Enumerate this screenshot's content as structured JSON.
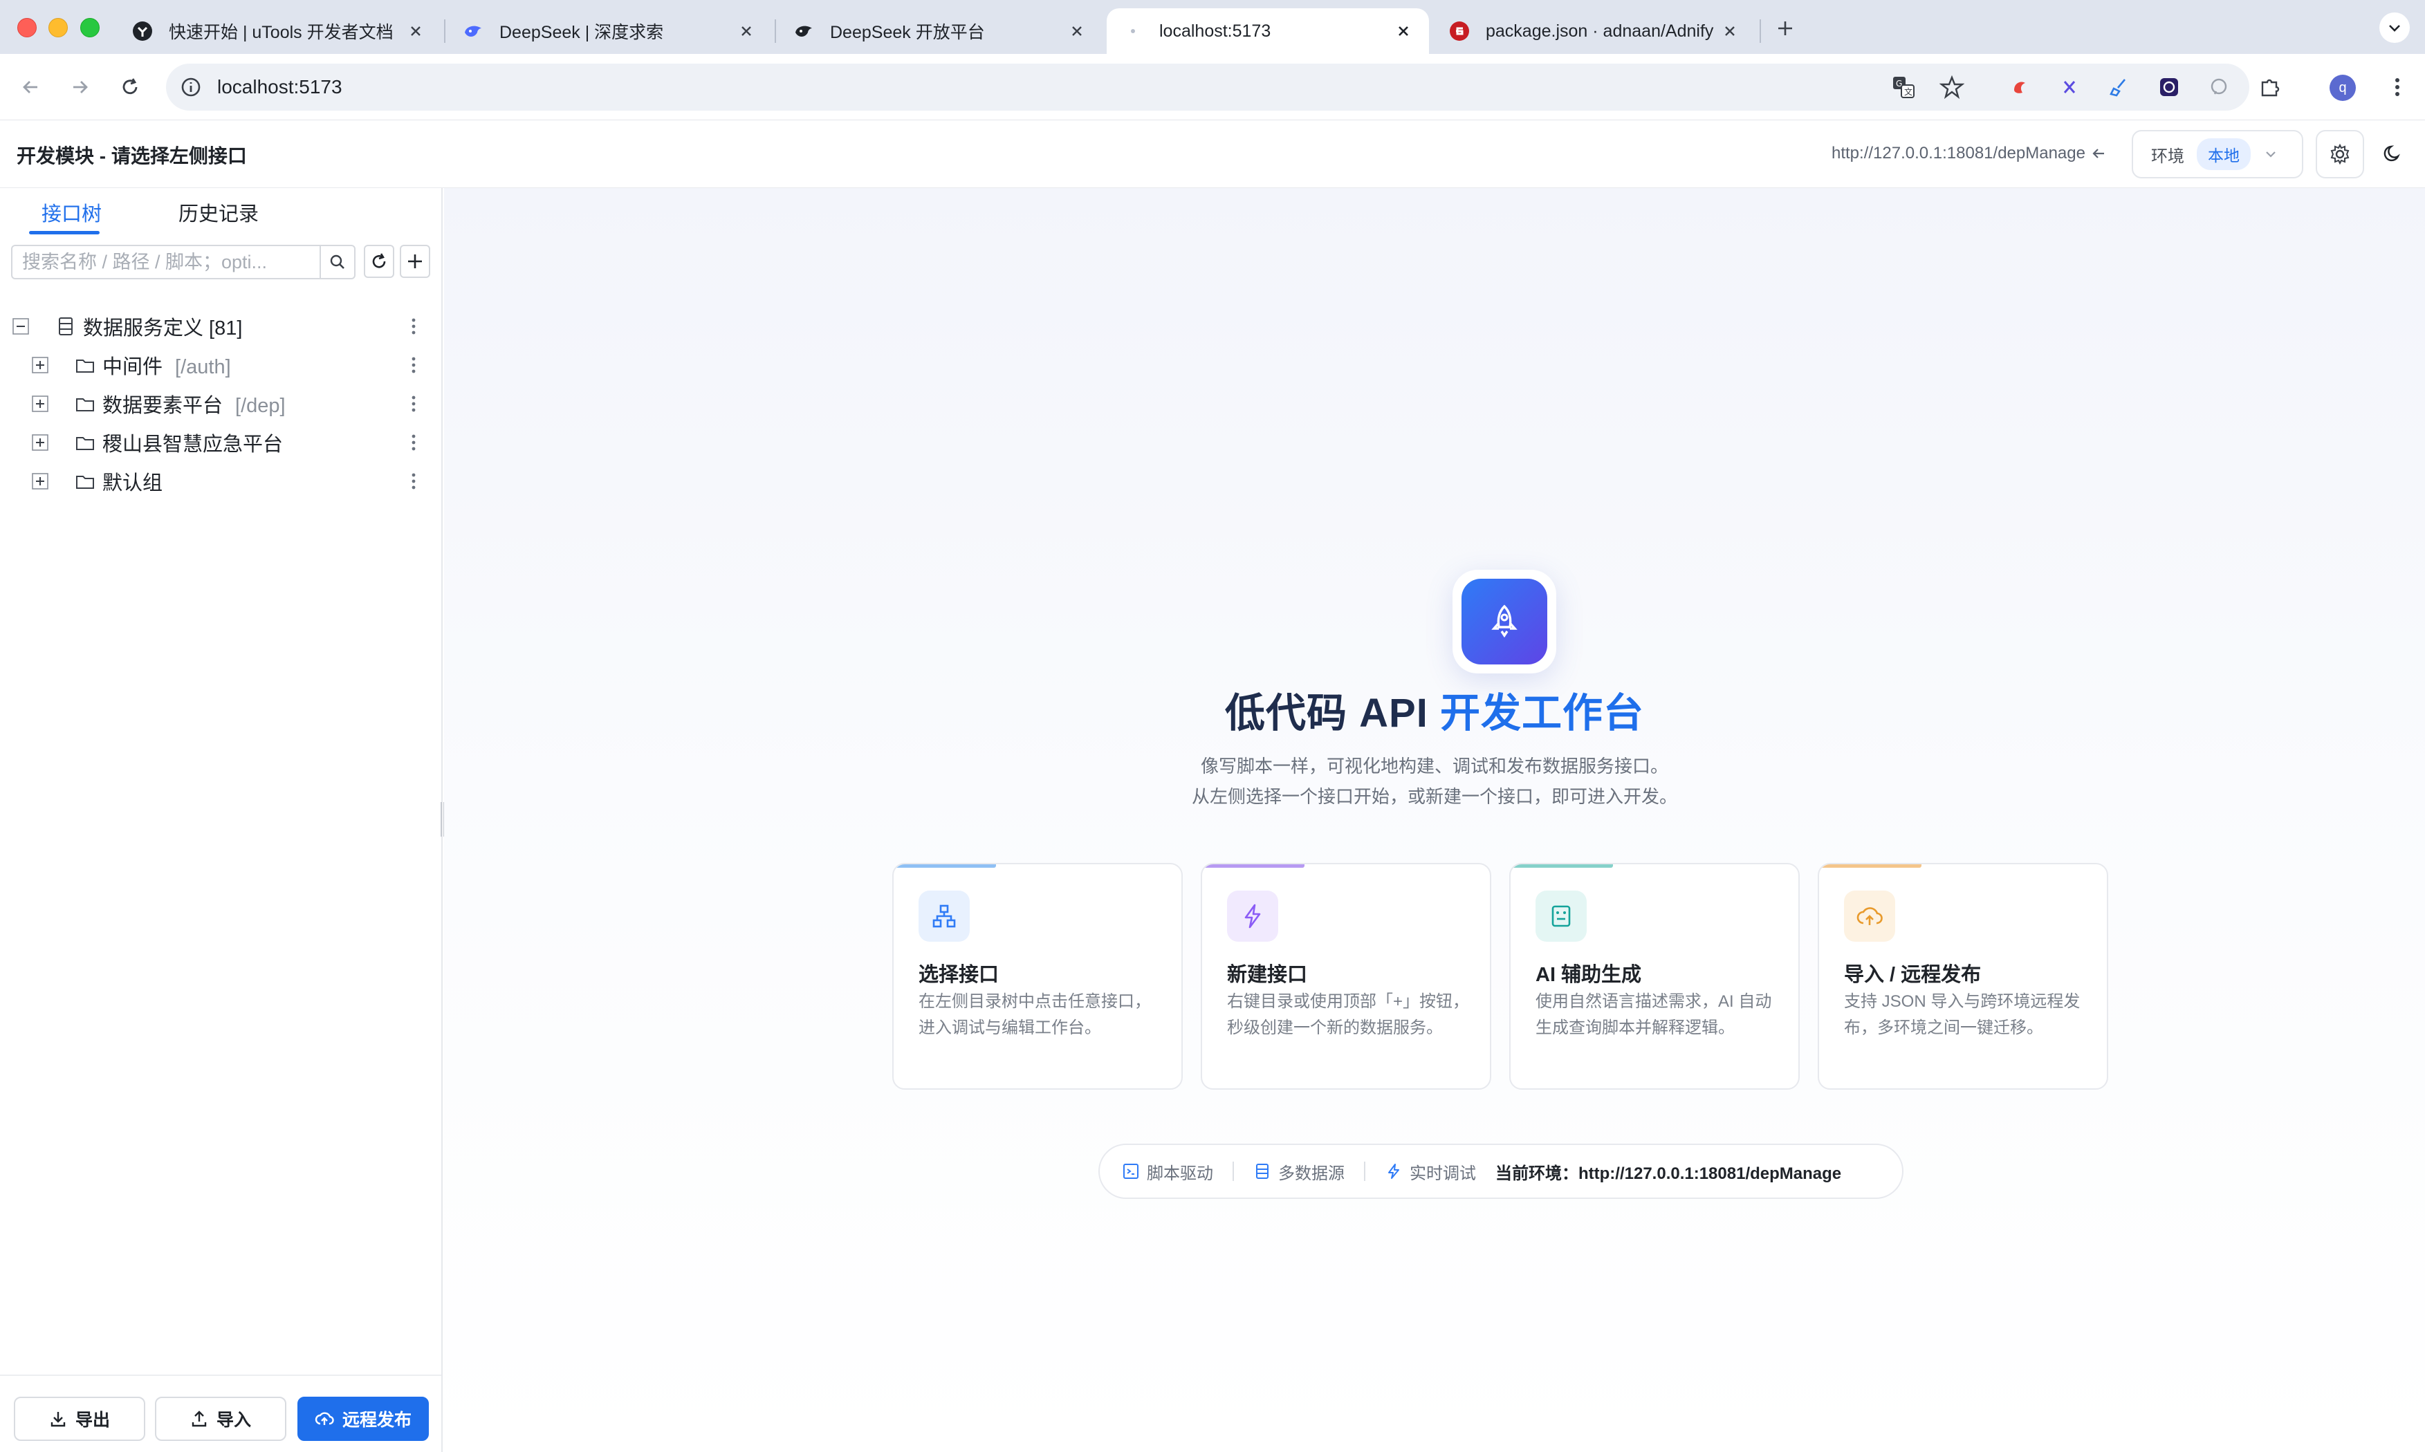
{
  "browser": {
    "tabs": [
      {
        "title": "快速开始 | uTools 开发者文档",
        "favicon": "utools-icon"
      },
      {
        "title": "DeepSeek | 深度求索",
        "favicon": "deepseek-whale-icon"
      },
      {
        "title": "DeepSeek 开放平台",
        "favicon": "deepseek-open-icon"
      },
      {
        "title": "localhost:5173",
        "favicon": "blank-icon",
        "active": true
      },
      {
        "title": "package.json · adnaan/Adnify",
        "favicon": "gitee-icon"
      }
    ],
    "url": "localhost:5173",
    "profile_initial": "q"
  },
  "header": {
    "title": "开发模块 - 请选择左侧接口",
    "base_url": "http://127.0.0.1:18081/depManage",
    "env_label": "环境",
    "env_value": "本地"
  },
  "sidebar": {
    "tabs": [
      "接口树",
      "历史记录"
    ],
    "search_placeholder": "搜索名称 / 路径 / 脚本；opti...",
    "tree": {
      "root": "数据服务定义 [81]",
      "children": [
        {
          "name": "中间件",
          "path": "[/auth]"
        },
        {
          "name": "数据要素平台",
          "path": "[/dep]"
        },
        {
          "name": "稷山县智慧应急平台",
          "path": ""
        },
        {
          "name": "默认组",
          "path": ""
        }
      ]
    },
    "footer": {
      "export": "导出",
      "import": "导入",
      "publish": "远程发布"
    }
  },
  "main": {
    "title_part1": "低代码 API",
    "title_part2": "开发工作台",
    "subtitle1": "像写脚本一样，可视化地构建、调试和发布数据服务接口。",
    "subtitle2": "从左侧选择一个接口开始，或新建一个接口，即可进入开发。",
    "cards": [
      {
        "title": "选择接口",
        "desc": "在左侧目录树中点击任意接口，进入调试与编辑工作台。",
        "icon": "sitemap-icon",
        "color": "#2f7bf6"
      },
      {
        "title": "新建接口",
        "desc": "右键目录或使用顶部「+」按钮，秒级创建一个新的数据服务。",
        "icon": "lightning-icon",
        "color": "#8b5cf6"
      },
      {
        "title": "AI 辅助生成",
        "desc": "使用自然语言描述需求，AI 自动生成查询脚本并解释逻辑。",
        "icon": "robot-icon",
        "color": "#14a39a"
      },
      {
        "title": "导入 / 远程发布",
        "desc": "支持 JSON 导入与跨环境远程发布，多环境之间一键迁移。",
        "icon": "cloud-upload-icon",
        "color": "#f0a23b"
      }
    ],
    "footer": {
      "feature1": "脚本驱动",
      "feature2": "多数据源",
      "feature3": "实时调试",
      "env_text": "当前环境：http://127.0.0.1:18081/depManage"
    }
  }
}
